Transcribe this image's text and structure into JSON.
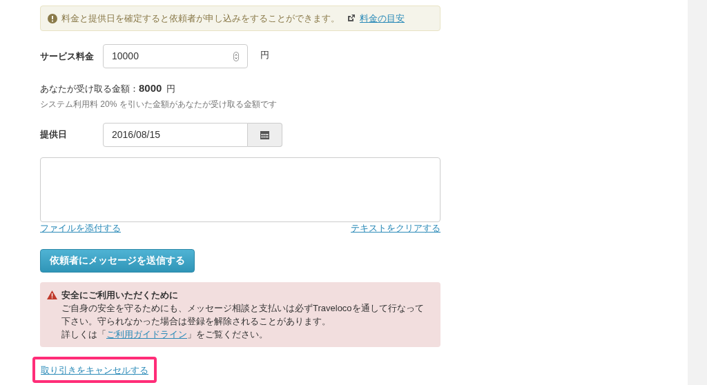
{
  "notice": {
    "text": "料金と提供日を確定すると依頼者が申し込みをすることができます。",
    "link": "料金の目安"
  },
  "fee": {
    "label": "サービス料金",
    "value": "10000",
    "unit": "円"
  },
  "receive": {
    "label": "あなたが受け取る金額：",
    "amount": "8000",
    "unit": "円",
    "note": "システム利用料 20% を引いた金額があなたが受け取る金額です"
  },
  "date": {
    "label": "提供日",
    "value": "2016/08/15"
  },
  "message": {
    "attach_link": "ファイルを添付する",
    "clear_link": "テキストをクリアする"
  },
  "send_button": "依頼者にメッセージを送信する",
  "warning": {
    "title": "安全にご利用いただくために",
    "lines": [
      "ご自身の安全を守るためにも、メッセージ相談と支払いは必ずTravelocoを通して行なって",
      "下さい。守られなかった場合は登録を解除されることがあります。"
    ],
    "detail_prefix": "詳しくは「",
    "detail_link": "ご利用ガイドライン",
    "detail_suffix": "」をご覧ください。"
  },
  "cancel": {
    "text": "取り引きをキャンセルする",
    "highlighted": true
  }
}
